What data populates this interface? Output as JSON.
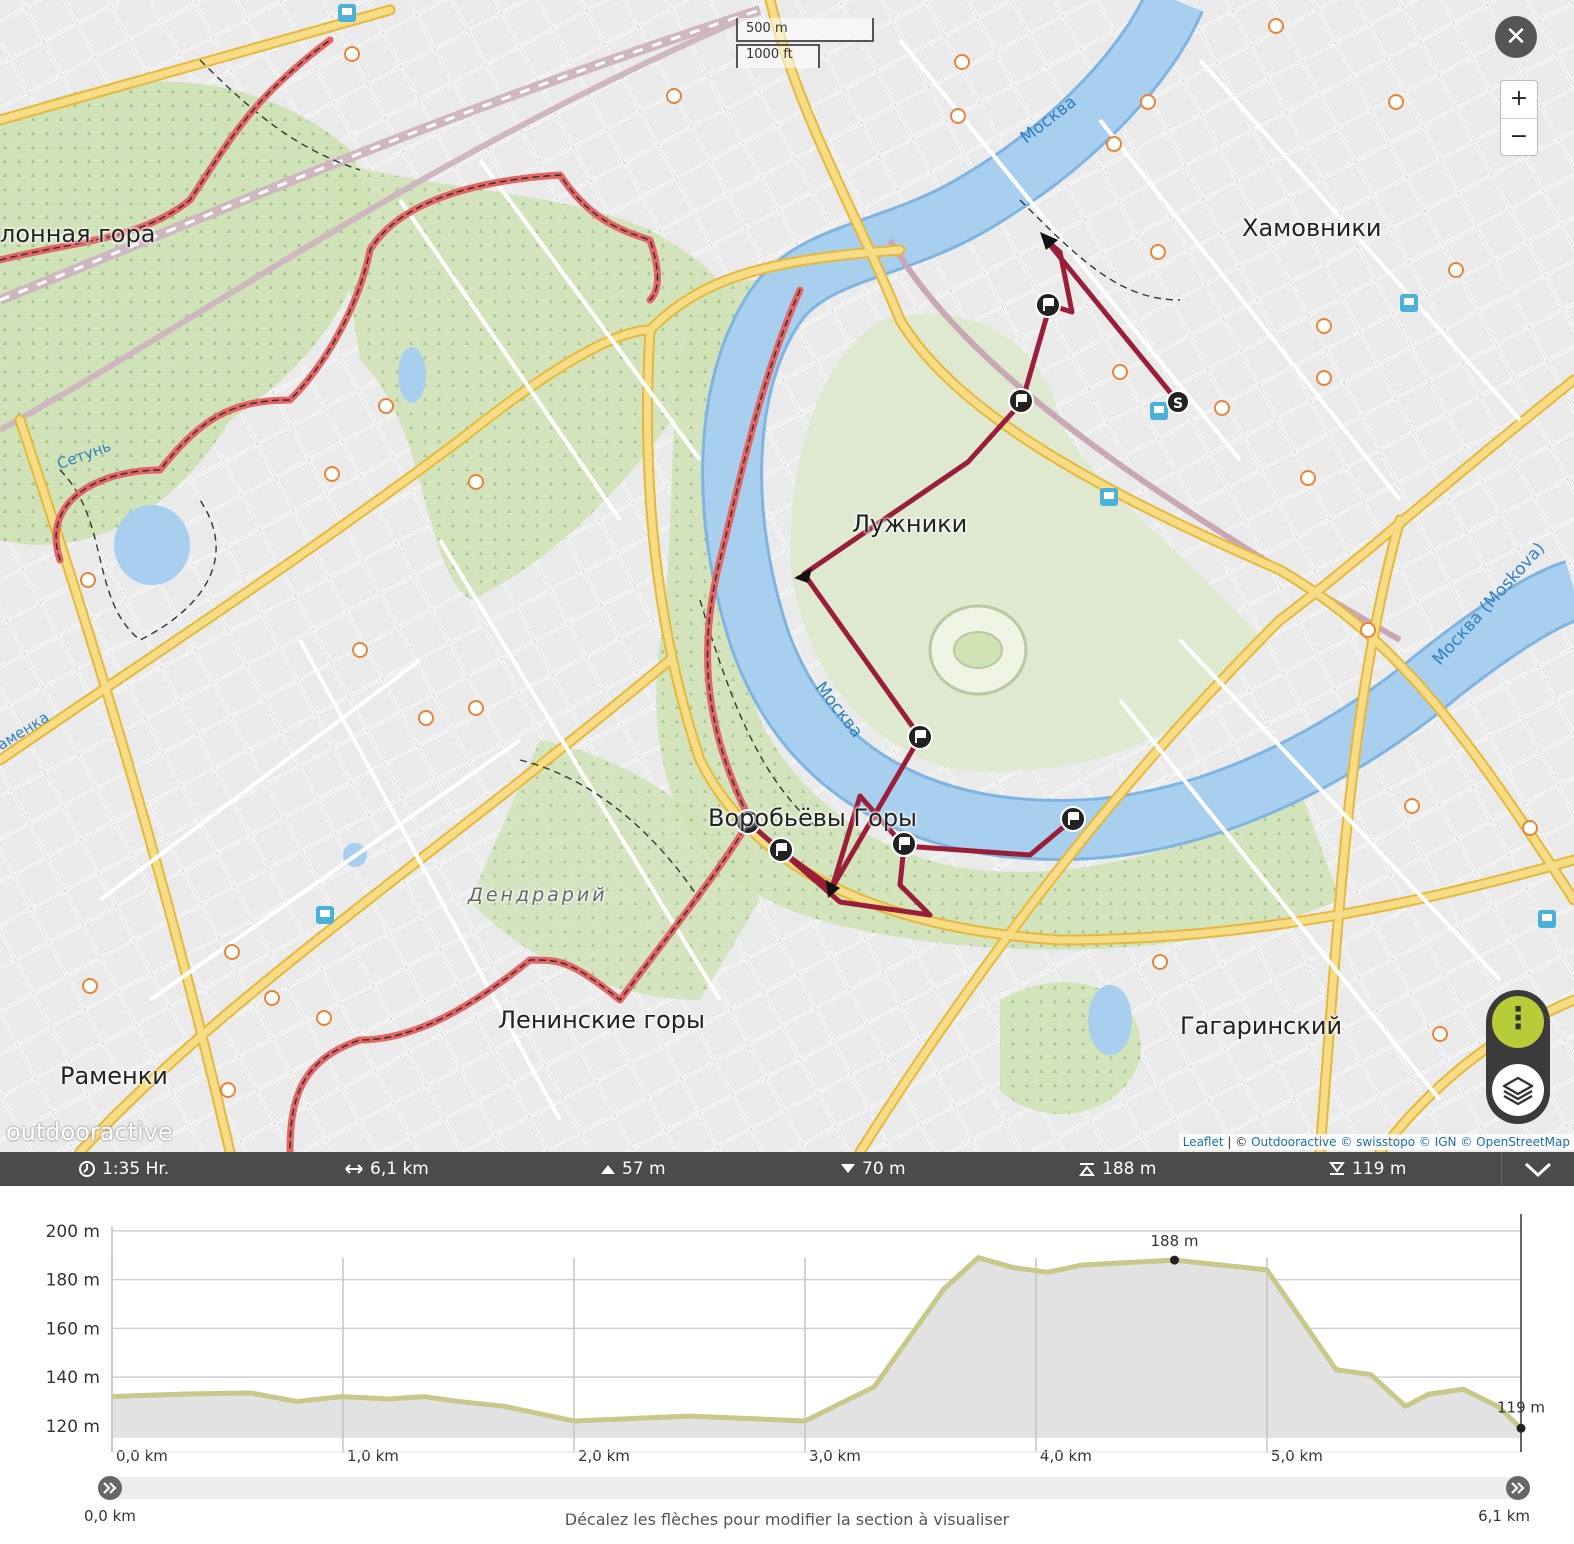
{
  "map": {
    "labels": {
      "khamovniki": "Хамовники",
      "luzhniki": "Лужники",
      "vorobyovy": "Воробьёвы Горы",
      "leninskie": "Ленинские горы",
      "gagarinsky": "Гагаринский",
      "ramenki": "Раменки",
      "poklonnaya": "лонная гора",
      "dendrariy": "Дендрарий",
      "setun": "Сетунь",
      "ramenka": "аменка"
    },
    "river_labels": {
      "top": "Москва",
      "middle": "Москва",
      "right": "Москва (Moskova)"
    },
    "scale": {
      "metric": "500 m",
      "imperial": "1000 ft"
    },
    "controls": {
      "close": "✕",
      "zoom_in": "+",
      "zoom_out": "−",
      "more": "⋮"
    },
    "attribution": {
      "leaflet": "Leaflet",
      "sep": " | © ",
      "outdooractive": "Outdooractive",
      "rest": " © swisstopo © IGN © OpenStreetMap"
    },
    "brand": "outdooractive",
    "start_marker": "S",
    "icons": [
      "close-icon",
      "zoom-in-icon",
      "zoom-out-icon",
      "more-icon",
      "layers-icon",
      "waypoint-flag-icon",
      "start-icon",
      "metro-icon",
      "poi-hut-icon"
    ],
    "colors": {
      "route": "#9a1e3a",
      "water": "#a8cfee",
      "park": "#cfe3b5",
      "road": "#f3d06a",
      "trail_red": "#e05555"
    }
  },
  "stats": {
    "duration": "1:35 Hr.",
    "distance": "6,1 km",
    "ascent": "57 m",
    "descent": "70 m",
    "max_alt": "188 m",
    "min_alt": "119 m"
  },
  "chart_data": {
    "type": "area",
    "title": "",
    "xlabel": "",
    "ylabel": "",
    "x_ticks": [
      "0,0 km",
      "1,0 km",
      "2,0 km",
      "3,0 km",
      "4,0 km",
      "5,0 km"
    ],
    "y_ticks": [
      "120 m",
      "140 m",
      "160 m",
      "180 m",
      "200 m"
    ],
    "xlim": [
      0,
      6.1
    ],
    "ylim": [
      115,
      202
    ],
    "x": [
      0,
      0.3,
      0.6,
      0.8,
      1.0,
      1.2,
      1.35,
      1.5,
      1.7,
      2.0,
      2.5,
      3.0,
      3.3,
      3.6,
      3.75,
      3.9,
      4.05,
      4.2,
      4.4,
      4.6,
      5.0,
      5.3,
      5.45,
      5.6,
      5.7,
      5.85,
      6.0,
      6.1
    ],
    "y": [
      132,
      133,
      133.5,
      130,
      132,
      131,
      132,
      130,
      128,
      122,
      124,
      122,
      136,
      176,
      189,
      185,
      183,
      186,
      187,
      188,
      184,
      143,
      141,
      128,
      133,
      135,
      128,
      119
    ],
    "annotations": [
      {
        "x": 4.6,
        "y": 188,
        "label": "188 m"
      },
      {
        "x": 6.1,
        "y": 119,
        "label": "119 m"
      }
    ],
    "range_start": "0,0 km",
    "range_end": "6,1 km",
    "series_color": "#c7c88a",
    "fill_color": "#e2e2e2"
  },
  "hint": "Décalez les flèches pour modifier la section à visualiser"
}
